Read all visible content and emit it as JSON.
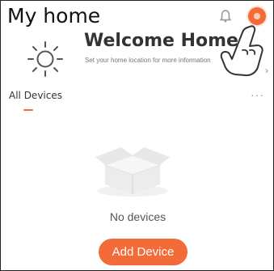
{
  "header": {
    "title": "My home"
  },
  "banner": {
    "heading": "Welcome Home",
    "subtext": "Set your home location for more information",
    "arrow": "›"
  },
  "devices": {
    "section_title": "All Devices",
    "more": "···",
    "empty_text": "No devices"
  },
  "actions": {
    "add_device_label": "Add Device"
  },
  "colors": {
    "accent": "#f46b3a",
    "text": "#333333",
    "muted": "#777777"
  }
}
